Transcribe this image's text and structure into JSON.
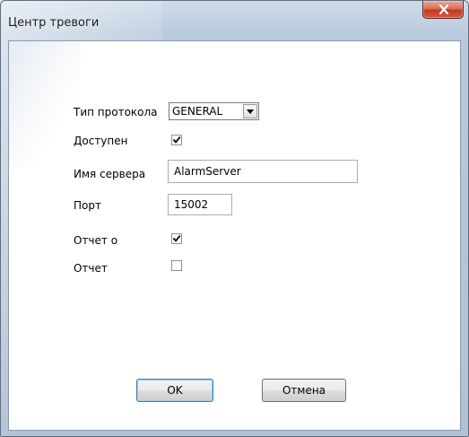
{
  "window": {
    "title": "Центр тревоги"
  },
  "form": {
    "protocol_label": "Тип протокола",
    "protocol_value": "GENERAL",
    "enabled_label": "Доступен",
    "enabled_checked": true,
    "server_name_label": "Имя сервера",
    "server_name_value": "AlarmServer",
    "port_label": "Порт",
    "port_value": "15002",
    "report_on_label": "Отчет о",
    "report_on_checked": true,
    "report_label": "Отчет",
    "report_checked": false
  },
  "buttons": {
    "ok_label": "OK",
    "cancel_label": "Отмена"
  },
  "icons": {
    "close": "close-icon",
    "dropdown": "chevron-down-icon",
    "check": "checkmark-icon"
  },
  "colors": {
    "close_button": "#c2391f",
    "frame": "#b9c9dc"
  }
}
